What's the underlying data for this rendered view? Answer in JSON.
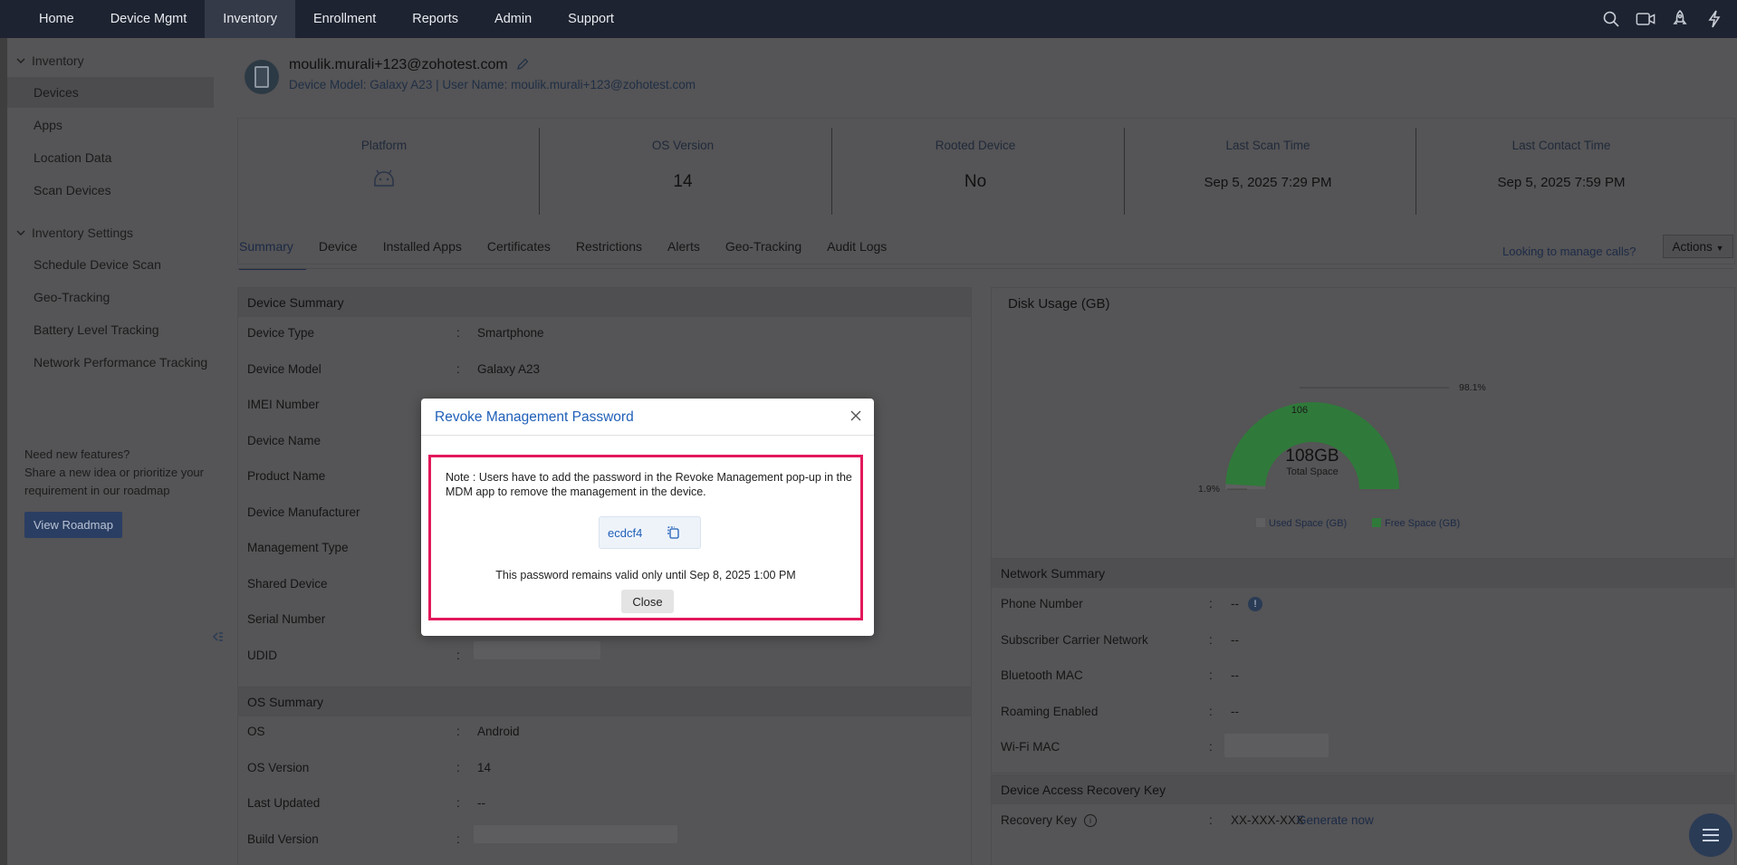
{
  "topnav": {
    "items": [
      "Home",
      "Device Mgmt",
      "Inventory",
      "Enrollment",
      "Reports",
      "Admin",
      "Support"
    ],
    "active": "Inventory",
    "icons": [
      "search-icon",
      "video-icon",
      "rocket-icon",
      "lightning-icon"
    ]
  },
  "sidebar": {
    "group1": "Inventory",
    "items1": [
      "Devices",
      "Apps",
      "Location Data",
      "Scan Devices"
    ],
    "group2": "Inventory Settings",
    "items2": [
      "Schedule Device Scan",
      "Geo-Tracking",
      "Battery Level Tracking",
      "Network Performance Tracking"
    ],
    "promo_title": "Need new features?",
    "promo_text": "Share a new idea or prioritize your requirement in our roadmap",
    "roadmap_button": "View Roadmap"
  },
  "device": {
    "title": "moulik.murali+123@zohotest.com",
    "subtitle": "Device Model: Galaxy A23 | User Name: moulik.murali+123@zohotest.com"
  },
  "stats": [
    {
      "label": "Platform",
      "value": ""
    },
    {
      "label": "OS Version",
      "value": "14"
    },
    {
      "label": "Rooted Device",
      "value": "No"
    },
    {
      "label": "Last Scan Time",
      "value": "Sep 5, 2025 7:29 PM"
    },
    {
      "label": "Last Contact Time",
      "value": "Sep 5, 2025 7:59 PM"
    }
  ],
  "tabs": [
    "Summary",
    "Device",
    "Installed Apps",
    "Certificates",
    "Restrictions",
    "Alerts",
    "Geo-Tracking",
    "Audit Logs"
  ],
  "manage_calls": "Looking to manage calls?",
  "actions": "Actions",
  "device_summary": {
    "title": "Device Summary",
    "rows": [
      {
        "label": "Device Type",
        "value": "Smartphone"
      },
      {
        "label": "Device Model",
        "value": "Galaxy A23"
      },
      {
        "label": "IMEI Number",
        "value": ""
      },
      {
        "label": "Device Name",
        "value": ""
      },
      {
        "label": "Product Name",
        "value": ""
      },
      {
        "label": "Device Manufacturer",
        "value": ""
      },
      {
        "label": "Management Type",
        "value": ""
      },
      {
        "label": "Shared Device",
        "value": ""
      },
      {
        "label": "Serial Number",
        "value": ""
      },
      {
        "label": "UDID",
        "value": ""
      }
    ]
  },
  "os_summary": {
    "title": "OS Summary",
    "rows": [
      {
        "label": "OS",
        "value": "Android"
      },
      {
        "label": "OS Version",
        "value": "14"
      },
      {
        "label": "Last Updated",
        "value": "--"
      },
      {
        "label": "Build Version",
        "value": ""
      }
    ]
  },
  "disk_usage": {
    "title": "Disk Usage (GB)",
    "center_value": "108GB",
    "center_label": "Total Space",
    "used_pct_label": "1.9%",
    "free_pct_label": "98.1%",
    "free_value_label": "106",
    "legend": [
      "Used Space (GB)",
      "Free Space (GB)"
    ]
  },
  "chart_data": {
    "type": "pie",
    "title": "Disk Usage (GB)",
    "categories": [
      "Used Space (GB)",
      "Free Space (GB)"
    ],
    "values": [
      2,
      106
    ],
    "percent": [
      1.9,
      98.1
    ],
    "colors": [
      "#5f5f61",
      "#2f7a3a"
    ],
    "total": "108GB",
    "legend": "bottom"
  },
  "network_summary": {
    "title": "Network Summary",
    "rows": [
      {
        "label": "Phone Number",
        "value": "--"
      },
      {
        "label": "Subscriber Carrier Network",
        "value": "--"
      },
      {
        "label": "Bluetooth MAC",
        "value": "--"
      },
      {
        "label": "Roaming Enabled",
        "value": "--"
      },
      {
        "label": "Wi-Fi MAC",
        "value": ""
      }
    ]
  },
  "recovery": {
    "title": "Device Access Recovery Key",
    "label": "Recovery Key",
    "value": "XX-XXX-XXX",
    "link": "Generate now"
  },
  "modal": {
    "title": "Revoke Management Password",
    "note": "Note : Users have to add the password in the Revoke Management pop-up in the MDM app to remove the management in the device.",
    "password": "ecdcf4",
    "validity": "This password remains valid only until Sep 8, 2025 1:00 PM",
    "close_button": "Close"
  },
  "colors": {
    "accent": "#1f5fb8",
    "highlight_border": "#e2185a",
    "nav_bg": "#1d2330"
  }
}
